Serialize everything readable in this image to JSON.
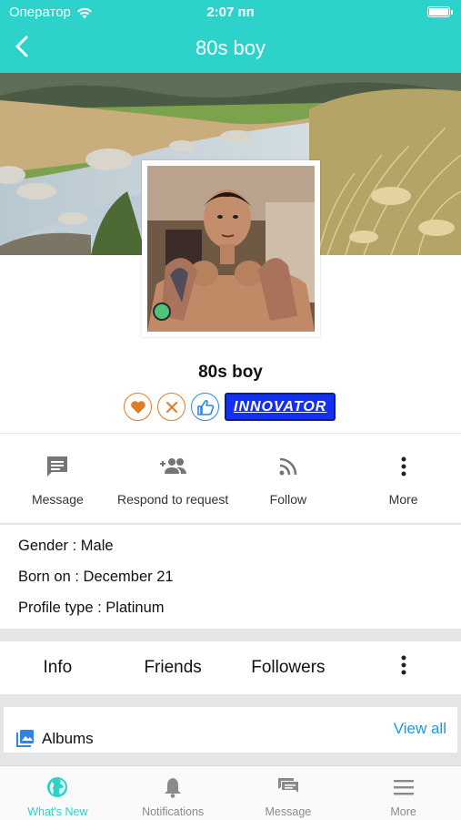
{
  "status_bar": {
    "carrier": "Оператор",
    "time": "2:07 пп"
  },
  "nav": {
    "title": "80s boy"
  },
  "profile": {
    "name": "80s boy",
    "badge_label": "INNOVATOR",
    "online": true
  },
  "actions": [
    {
      "label": "Message",
      "icon": "message-icon"
    },
    {
      "label": "Respond to request",
      "icon": "add-friend-icon"
    },
    {
      "label": "Follow",
      "icon": "rss-icon"
    },
    {
      "label": "More",
      "icon": "more-vertical-icon"
    }
  ],
  "details": {
    "gender": "Gender : Male",
    "born": "Born on : December 21",
    "profile_type": "Profile type : Platinum"
  },
  "tabs": [
    "Info",
    "Friends",
    "Followers"
  ],
  "albums": {
    "title": "Albums",
    "view_all": "View all"
  },
  "tabbar": [
    {
      "label": "What's New",
      "icon": "globe-icon",
      "active": true
    },
    {
      "label": "Notifications",
      "icon": "bell-icon"
    },
    {
      "label": "Message",
      "icon": "chat-icon"
    },
    {
      "label": "More",
      "icon": "menu-icon"
    }
  ],
  "colors": {
    "accent": "#2dd3ca",
    "badge_blue": "#1330f0",
    "link": "#1a9bd7",
    "online": "#4fc37a"
  }
}
